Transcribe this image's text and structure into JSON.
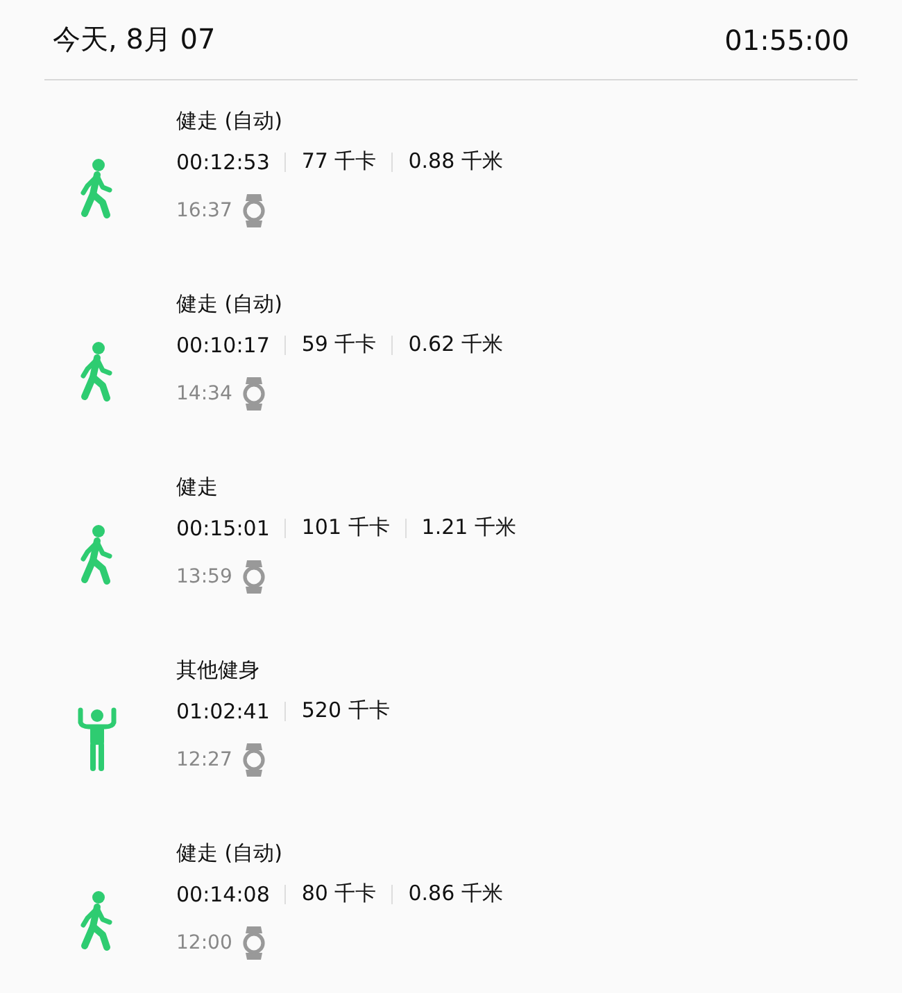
{
  "header": {
    "date": "今天, 8月 07",
    "total": "01:55:00"
  },
  "entries": [
    {
      "kind": "walk",
      "title": "健走 (自动)",
      "stats": [
        "00:12:53",
        "77 千卡",
        "0.88 千米"
      ],
      "time": "16:37"
    },
    {
      "kind": "walk",
      "title": "健走 (自动)",
      "stats": [
        "00:10:17",
        "59 千卡",
        "0.62 千米"
      ],
      "time": "14:34"
    },
    {
      "kind": "walk",
      "title": "健走",
      "stats": [
        "00:15:01",
        "101 千卡",
        "1.21 千米"
      ],
      "time": "13:59"
    },
    {
      "kind": "workout",
      "title": "其他健身",
      "stats": [
        "01:02:41",
        "520 千卡"
      ],
      "time": "12:27"
    },
    {
      "kind": "walk",
      "title": "健走 (自动)",
      "stats": [
        "00:14:08",
        "80 千卡",
        "0.86 千米"
      ],
      "time": "12:00"
    }
  ]
}
